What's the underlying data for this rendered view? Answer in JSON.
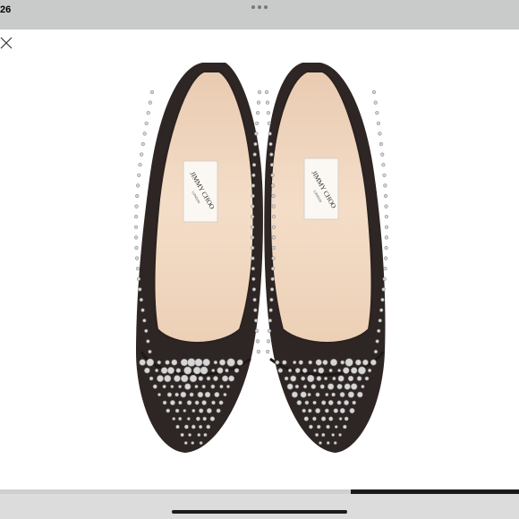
{
  "status_bar": {
    "time": "26"
  },
  "toolbar": {
    "more_icon": "more-dots-icon",
    "close_icon": "close-x-icon"
  },
  "product": {
    "brand_label_line1": "JIMMY CHOO",
    "brand_label_line2": "LONDON"
  },
  "carousel": {
    "progress_fraction": 0.325
  },
  "colors": {
    "status_bar": "#c9cbca",
    "shoe_leather": "#2e2624",
    "insole": "#f0d6bf",
    "stud": "#d9d9d9"
  }
}
